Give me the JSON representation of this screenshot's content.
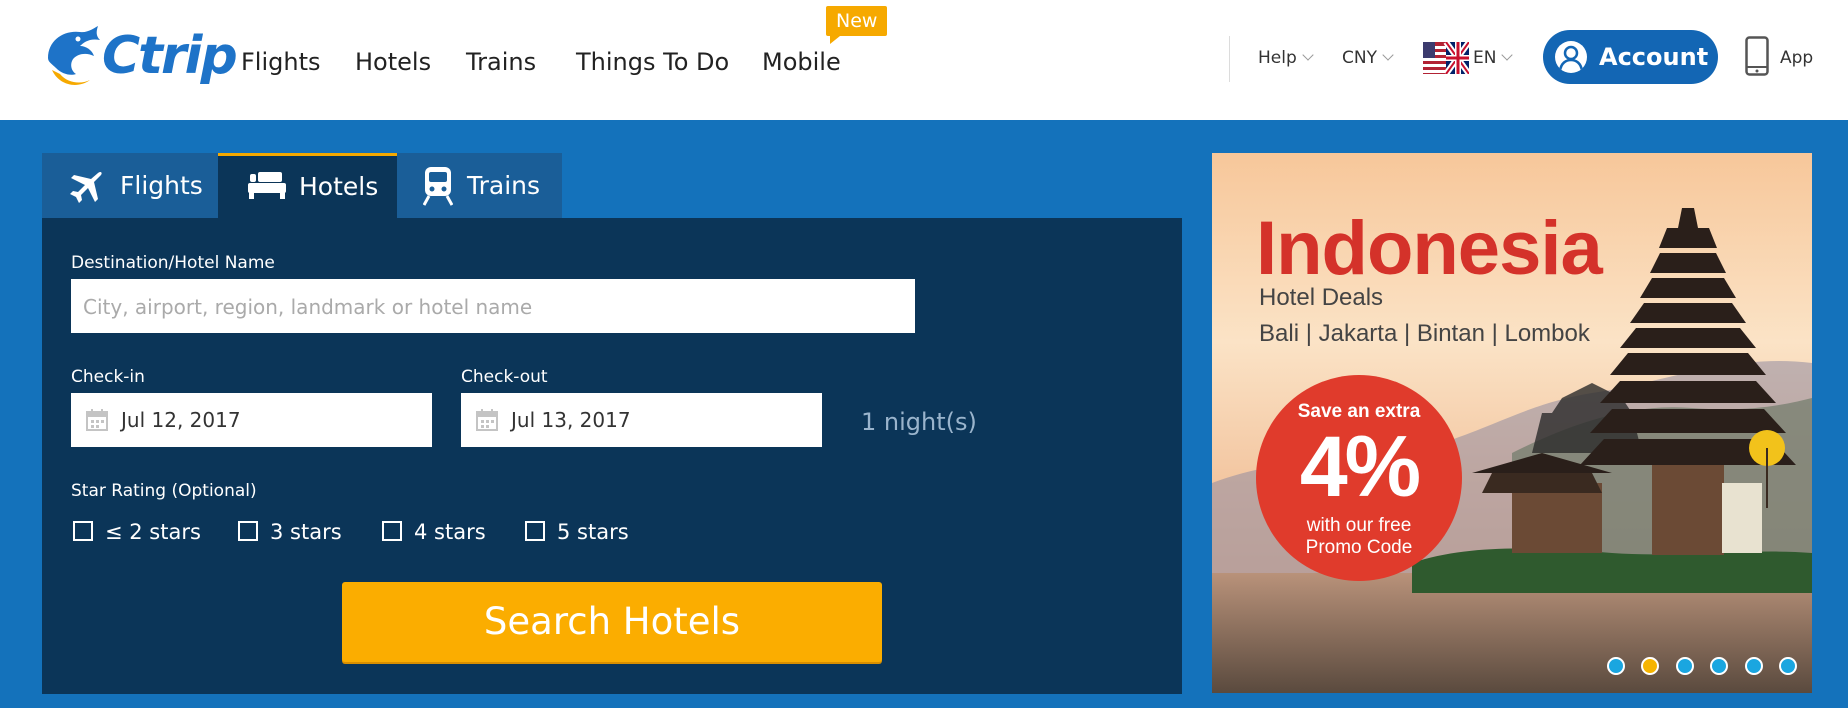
{
  "header": {
    "brand": "Ctrip",
    "nav": [
      {
        "label": "Flights"
      },
      {
        "label": "Hotels"
      },
      {
        "label": "Trains"
      },
      {
        "label": "Things To Do"
      },
      {
        "label": "Mobile"
      }
    ],
    "new_badge": "New",
    "help": "Help",
    "currency": "CNY",
    "language": "EN",
    "account": "Account",
    "app": "App"
  },
  "search": {
    "tabs": [
      {
        "label": "Flights",
        "icon": "airplane-icon",
        "active": false
      },
      {
        "label": "Hotels",
        "icon": "bed-icon",
        "active": true
      },
      {
        "label": "Trains",
        "icon": "train-icon",
        "active": false
      }
    ],
    "destination_label": "Destination/Hotel Name",
    "destination_placeholder": "City, airport, region, landmark or hotel name",
    "checkin_label": "Check-in",
    "checkin_value": "Jul 12, 2017",
    "checkout_label": "Check-out",
    "checkout_value": "Jul 13, 2017",
    "nights": "1 night(s)",
    "star_label": "Star Rating (Optional)",
    "stars": [
      "≤ 2 stars",
      "3 stars",
      "4 stars",
      "5 stars"
    ],
    "button": "Search Hotels"
  },
  "promo": {
    "title": "Indonesia",
    "subtitle": "Hotel Deals",
    "places": "Bali | Jakarta | Bintan | Lombok",
    "badge_top": "Save an extra",
    "badge_big": "4%",
    "badge_bottom_1": "with our free",
    "badge_bottom_2": "Promo Code",
    "slide_count": 6,
    "active_slide": 2
  },
  "colors": {
    "brand_blue": "#1472bb",
    "panel_navy": "#0b3558",
    "accent_orange": "#fbad00",
    "promo_red": "#d4322a"
  }
}
